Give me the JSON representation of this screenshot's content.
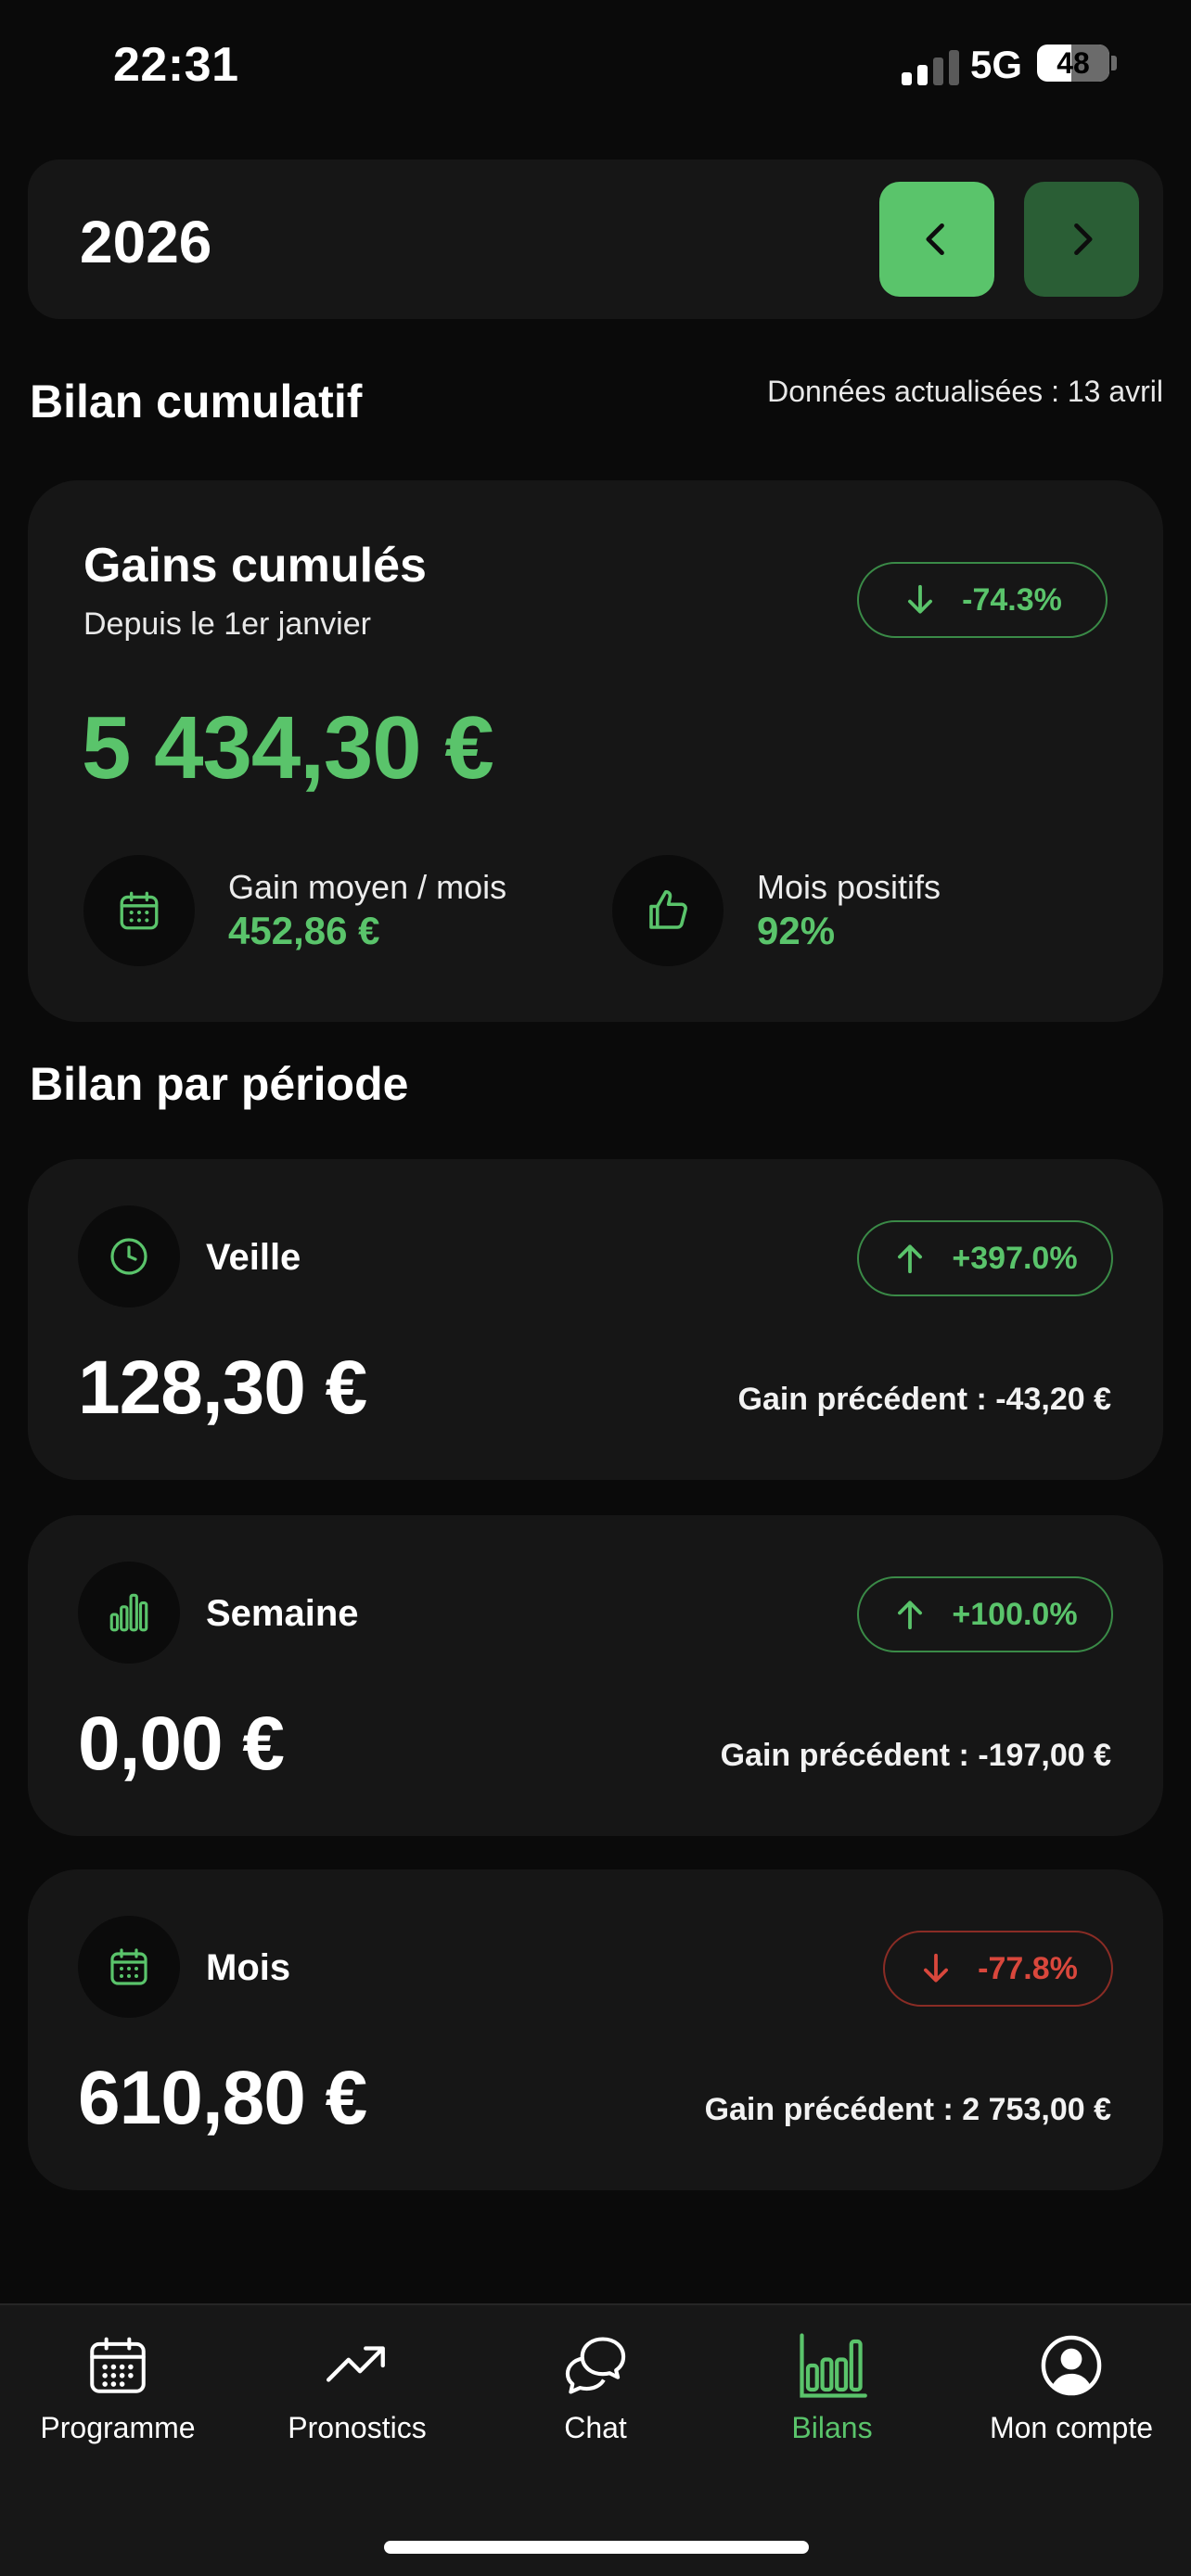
{
  "status_bar": {
    "time": "22:31",
    "network": "5G",
    "battery": "48",
    "battery_level": 0.48
  },
  "year_bar": {
    "year": "2026",
    "prev_icon": "chevron-left-icon",
    "next_icon": "chevron-right-icon"
  },
  "cumulative": {
    "section_title": "Bilan cumulatif",
    "updated_text": "Données actualisées : 13 avril",
    "card_title": "Gains cumulés",
    "card_subtitle": "Depuis le 1er janvier",
    "change": "-74.3%",
    "amount": "5 434,30 €",
    "stats": [
      {
        "label": "Gain moyen / mois",
        "value": "452,86 €",
        "icon": "calendar-icon"
      },
      {
        "label": "Mois positifs",
        "value": "92%",
        "icon": "thumbs-up-icon"
      }
    ]
  },
  "periods": {
    "section_title": "Bilan par période",
    "items": [
      {
        "name": "Veille",
        "icon": "clock-icon",
        "change": "+397.0%",
        "direction": "up",
        "amount": "128,30 €",
        "previous": "Gain précédent : -43,20 €"
      },
      {
        "name": "Semaine",
        "icon": "bar-chart-icon",
        "change": "+100.0%",
        "direction": "up",
        "amount": "0,00 €",
        "previous": "Gain précédent : -197,00 €"
      },
      {
        "name": "Mois",
        "icon": "calendar-icon",
        "change": "-77.8%",
        "direction": "down",
        "amount": "610,80 €",
        "previous": "Gain précédent : 2 753,00 €"
      }
    ]
  },
  "tabbar": {
    "active": "Bilans",
    "items": [
      {
        "label": "Programme",
        "icon": "calendar-icon"
      },
      {
        "label": "Pronostics",
        "icon": "trending-up-icon"
      },
      {
        "label": "Chat",
        "icon": "chat-bubbles-icon"
      },
      {
        "label": "Bilans",
        "icon": "bar-chart-icon"
      },
      {
        "label": "Mon compte",
        "icon": "user-circle-icon"
      }
    ]
  },
  "colors": {
    "accent": "#5ac46b",
    "accent_dark": "#2a5e35",
    "negative": "#d9473c",
    "card": "#161616",
    "background": "#0a0a0a"
  }
}
